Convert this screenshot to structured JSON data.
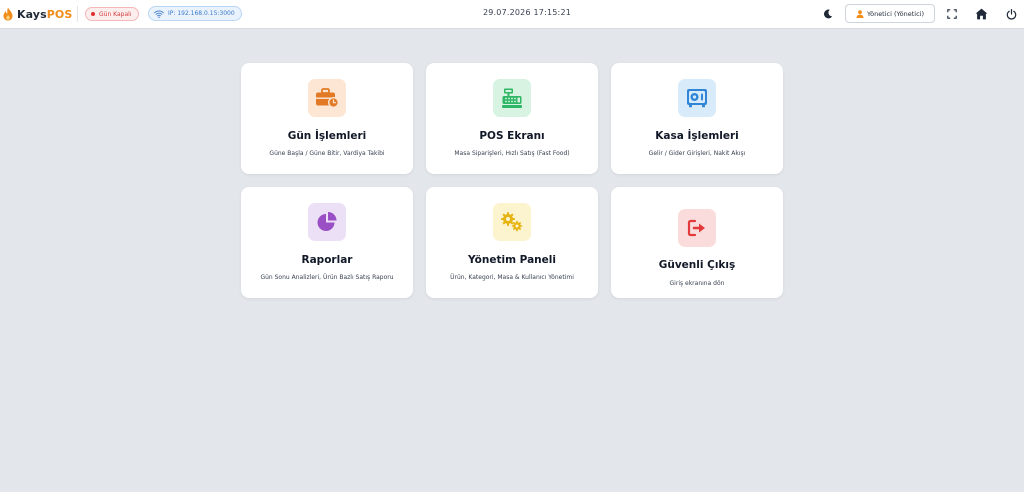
{
  "brand": {
    "name_dark": "Kays",
    "name_accent": "POS"
  },
  "status": {
    "day_state": "Gün Kapalı",
    "ip": "IP: 192.168.0.15:3000"
  },
  "header": {
    "datetime": "29.07.2026 17:15:21"
  },
  "user": {
    "label": "Yönetici (Yönetici)"
  },
  "icons": {
    "brand": "flame-icon",
    "theme": "moon-icon",
    "fullscreen": "fullscreen-icon",
    "home": "home-icon",
    "power": "power-icon"
  },
  "colors": {
    "accent": "#f08c1a",
    "danger": "#e03131",
    "info": "#3a78c9"
  },
  "cards": [
    {
      "title": "Gün İşlemleri",
      "desc": "Güne Başla / Güne Bitir, Vardiya Takibi",
      "icon": "briefcase-clock-icon"
    },
    {
      "title": "POS Ekranı",
      "desc": "Masa Siparişleri, Hızlı Satış (Fast Food)",
      "icon": "cash-register-icon"
    },
    {
      "title": "Kasa İşlemleri",
      "desc": "Gelir / Gider Girişleri, Nakit Akışı",
      "icon": "safe-icon"
    },
    {
      "title": "Raporlar",
      "desc": "Gün Sonu Analizleri, Ürün Bazlı Satış Raporu",
      "icon": "pie-chart-icon"
    },
    {
      "title": "Yönetim Paneli",
      "desc": "Ürün, Kategori, Masa & Kullanıcı Yönetimi",
      "icon": "gears-icon"
    },
    {
      "title": "Güvenli Çıkış",
      "desc": "Giriş ekranına dön",
      "icon": "logout-icon"
    }
  ]
}
